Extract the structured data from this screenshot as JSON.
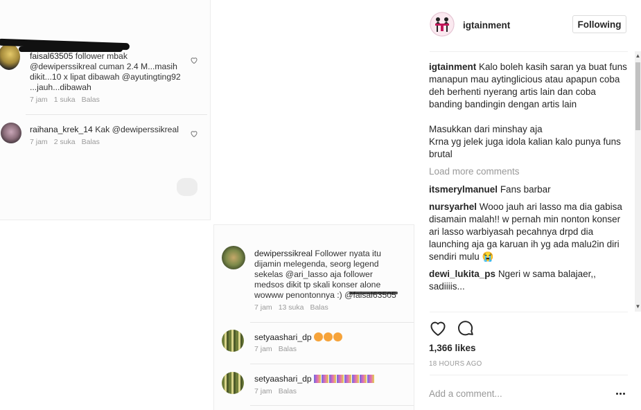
{
  "post": {
    "username": "igtainment",
    "follow_label": "Following",
    "caption_username": "igtainment",
    "caption_text": "Kalo boleh kasih saran ya buat funs manapun mau aytinglicious atau apapun coba deh berhenti nyerang artis lain dan coba banding bandingin dengan artis lain\n\nMasukkan dari minshay aja\nKrna yg jelek juga idola kalian kalo punya funs brutal",
    "load_more": "Load more comments",
    "comments": [
      {
        "username": "itsmerylmanuel",
        "text": "Fans barbar"
      },
      {
        "username": "nursyarhel",
        "text": "Wooo jauh ari lasso ma dia gabisa disamain malah!! w pernah min nonton konser ari lasso warbiyasah pecahnya drpd dia launching aja ga karuan ih yg ada malu2in diri sendiri mulu 😭"
      },
      {
        "username": "dewi_lukita_ps",
        "text": "Ngeri w sama balajaer,, sadiiiis..."
      }
    ],
    "likes": "1,366 likes",
    "timestamp": "18 HOURS AGO",
    "comment_placeholder": "Add a comment..."
  },
  "image": {
    "shot1": {
      "comments": [
        {
          "username": "faisal63505",
          "text": "follower mbak @dewiperssikreal cuman 2.4 M...masih dikit...10 x lipat dibawah @ayutingting92 ...jauh...dibawah",
          "time": "7 jam",
          "likes": "1 suka",
          "reply": "Balas"
        },
        {
          "username": "raihana_krek_14",
          "text": "Kak @dewiperssikreal",
          "time": "7 jam",
          "likes": "2 suka",
          "reply": "Balas"
        }
      ]
    },
    "shot2": {
      "comments": [
        {
          "username": "dewiperssikreal",
          "text": "Follower nyata itu dijamin melegenda, seorg legend sekelas @ari_lasso aja follower medsos dikit tp skali konser alone wowww penontonnya :) @faisal63505",
          "time": "7 jam",
          "likes": "13 suka",
          "reply": "Balas"
        },
        {
          "username": "setyaashari_dp",
          "time": "7 jam",
          "reply": "Balas"
        },
        {
          "username": "setyaashari_dp",
          "time": "7 jam",
          "reply": "Balas"
        }
      ]
    }
  },
  "colors": {
    "text": "#262626",
    "muted": "#999999",
    "border": "#dbdbdb"
  }
}
